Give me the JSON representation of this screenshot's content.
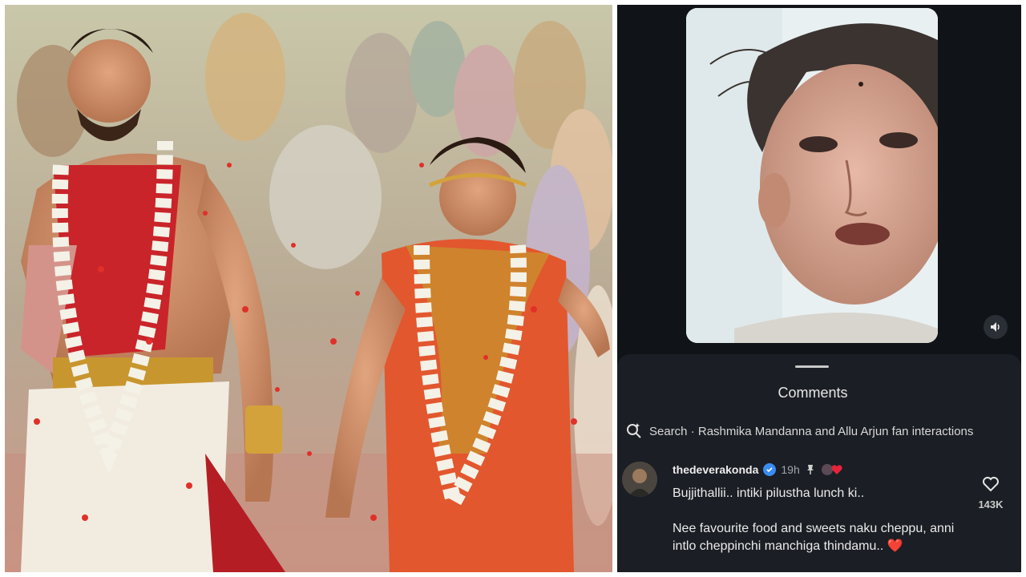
{
  "left_photo": {
    "description_icon": "wedding-photo"
  },
  "video": {
    "mute_icon": "speaker-icon"
  },
  "comments_sheet": {
    "title": "Comments",
    "search": {
      "icon": "search-icon",
      "label": "Search · Rashmika Mandanna and Allu Arjun fan interactions"
    },
    "comment": {
      "username": "thedeverakonda",
      "time": "19h",
      "text_line1": "Bujjithallii.. intiki pilustha lunch ki..",
      "text_line2": "Nee favourite food and sweets naku cheppu, anni intlo cheppinchi manchiga thindamu..",
      "emoji": "❤️",
      "like_count": "143K"
    }
  },
  "colors": {
    "sheet_bg": "#1b1e24",
    "panel_bg": "#101318",
    "verified": "#3b8cf2",
    "heart": "#e5243b"
  }
}
